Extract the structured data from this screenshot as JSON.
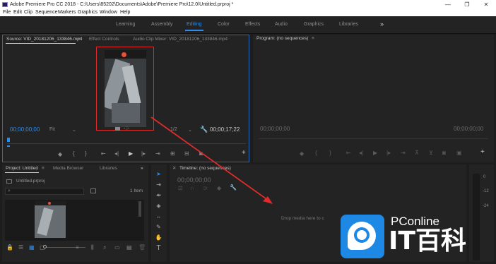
{
  "window": {
    "title": "Adobe Premiere Pro CC 2018 - C:\\Users\\85202\\Documents\\Adobe\\Premiere Pro\\12.0\\Untitled.prproj *",
    "controls": {
      "minimize": "—",
      "maximize": "❐",
      "close": "✕"
    }
  },
  "menu": [
    "File",
    "Edit",
    "Clip",
    "Sequence",
    "Markers",
    "Graphics",
    "Window",
    "Help"
  ],
  "workspaces": {
    "tabs": [
      "Learning",
      "Assembly",
      "Editing",
      "Color",
      "Effects",
      "Audio",
      "Graphics",
      "Libraries"
    ],
    "active": "Editing",
    "more": "»"
  },
  "source_panel": {
    "tabs": [
      "Source: VID_20181206_133846.mp4",
      "Effect Controls",
      "Audio Clip Mixer: VID_20181206_133846.mp4"
    ],
    "menu_glyph": "≡",
    "timecode_in": "00;00;00;00",
    "fit": "Fit",
    "resolution": "1/2",
    "timecode_out": "00;00;17;22"
  },
  "program_panel": {
    "title": "Program: (no sequences)",
    "menu_glyph": "≡",
    "timecode_in": "00;00;00;00",
    "timecode_out": "00;00;00;00"
  },
  "project_panel": {
    "tabs": [
      "Project: Untitled",
      "Media Browser",
      "Libraries"
    ],
    "project_file": "Untitled.prproj",
    "item_count": "1 Item",
    "more": "»"
  },
  "timeline_panel": {
    "title": "Timeline: (no sequences)",
    "timecode": "00;00;00;00",
    "drop_hint": "Drop media here to c"
  },
  "meters": [
    "0",
    "-12",
    "-24"
  ],
  "watermark": {
    "brand": "PConline",
    "cn": "IT百科"
  },
  "colors": {
    "accent": "#2d8ceb",
    "annotation": "#e02b2b",
    "record": "#e8513a"
  }
}
